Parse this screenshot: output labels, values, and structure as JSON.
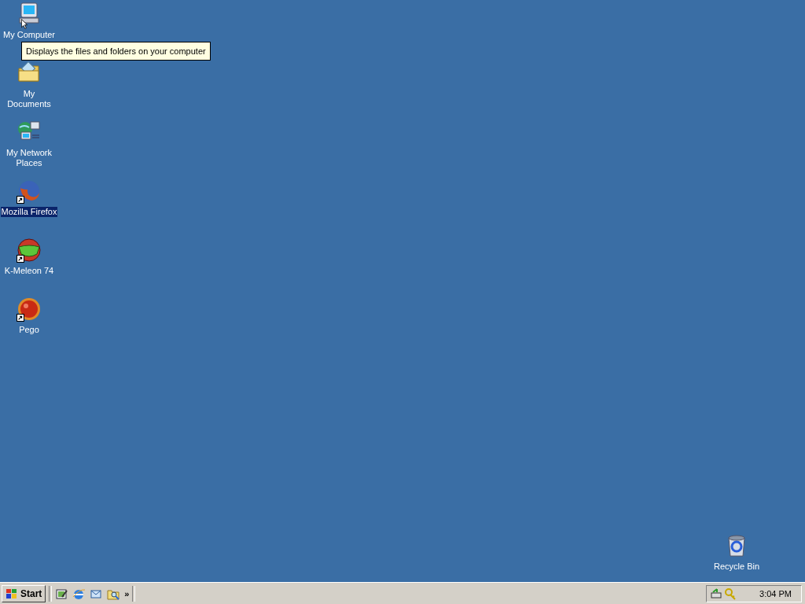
{
  "desktop_icons": [
    {
      "label": "My Computer",
      "kind": "computer",
      "shortcut": false,
      "selected": false
    },
    {
      "label": "My Documents",
      "kind": "documents",
      "shortcut": false,
      "selected": false
    },
    {
      "label": "My Network Places",
      "kind": "network",
      "shortcut": false,
      "selected": false
    },
    {
      "label": "Mozilla Firefox",
      "kind": "firefox",
      "shortcut": true,
      "selected": true
    },
    {
      "label": "K-Meleon 74",
      "kind": "kmeleon",
      "shortcut": true,
      "selected": false
    },
    {
      "label": "Pego",
      "kind": "pego",
      "shortcut": true,
      "selected": false
    }
  ],
  "recycle_bin": {
    "label": "Recycle Bin",
    "kind": "recycle",
    "shortcut": false,
    "selected": false
  },
  "tooltip": "Displays the files and folders on your computer",
  "taskbar": {
    "start_label": "Start",
    "quick_launch": [
      {
        "kind": "desktop"
      },
      {
        "kind": "browser"
      },
      {
        "kind": "mail"
      },
      {
        "kind": "search"
      }
    ],
    "more_label": "»",
    "tray_icons": [
      {
        "kind": "network"
      },
      {
        "kind": "key"
      }
    ],
    "clock": "3:04 PM"
  }
}
